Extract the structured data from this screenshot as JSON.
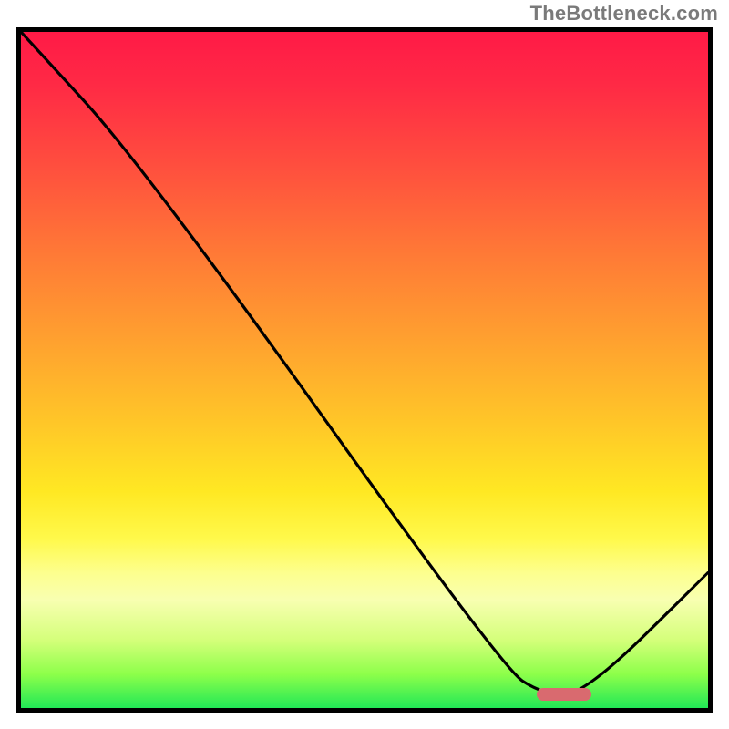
{
  "watermark": "TheBottleneck.com",
  "chart_data": {
    "type": "line",
    "title": "",
    "xlabel": "",
    "ylabel": "",
    "xlim": [
      0,
      100
    ],
    "ylim": [
      0,
      100
    ],
    "grid": false,
    "legend": false,
    "series": [
      {
        "name": "bottleneck-curve",
        "x": [
          0,
          18,
          70,
          76,
          82,
          100
        ],
        "values": [
          100,
          80,
          6,
          2,
          2,
          20
        ]
      }
    ],
    "marker": {
      "name": "optimal-range",
      "x_start": 75,
      "x_end": 83,
      "y": 2,
      "color": "#d96a6f"
    },
    "background_gradient": {
      "orientation": "vertical",
      "stops": [
        {
          "pos": 0,
          "color": "#ff1a46"
        },
        {
          "pos": 33,
          "color": "#ff7a36"
        },
        {
          "pos": 58,
          "color": "#ffc728"
        },
        {
          "pos": 80,
          "color": "#fdff8e"
        },
        {
          "pos": 100,
          "color": "#22e856"
        }
      ]
    }
  }
}
